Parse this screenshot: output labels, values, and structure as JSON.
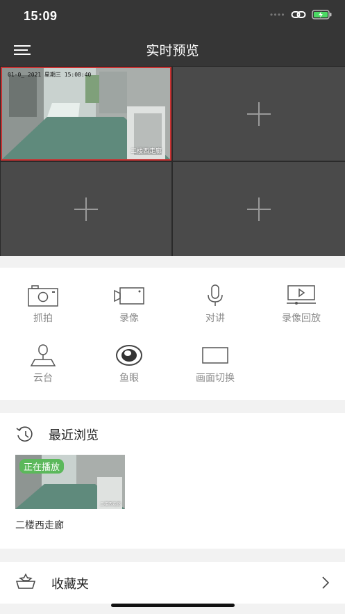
{
  "status_bar": {
    "time": "15:09"
  },
  "nav": {
    "title": "实时预览"
  },
  "video_grid": {
    "channels": [
      {
        "osd_time": "01-0_ 2021 星期三 15:08:40",
        "name": "二楼西走廊"
      }
    ]
  },
  "tools": [
    {
      "label": "抓拍",
      "icon": "camera-icon"
    },
    {
      "label": "录像",
      "icon": "video-camera-icon"
    },
    {
      "label": "对讲",
      "icon": "microphone-icon"
    },
    {
      "label": "录像回放",
      "icon": "playback-icon"
    },
    {
      "label": "云台",
      "icon": "ptz-icon"
    },
    {
      "label": "鱼眼",
      "icon": "fisheye-icon"
    },
    {
      "label": "画面切换",
      "icon": "split-screen-icon"
    }
  ],
  "recent": {
    "title": "最近浏览",
    "items": [
      {
        "badge": "正在播放",
        "name": "二楼西走廊",
        "osd_name": "二楼西走廊"
      }
    ]
  },
  "favorites": {
    "label": "收藏夹"
  },
  "colors": {
    "header_bg": "#363636",
    "selected_border": "#c83232",
    "badge_green": "#5bb85b"
  }
}
